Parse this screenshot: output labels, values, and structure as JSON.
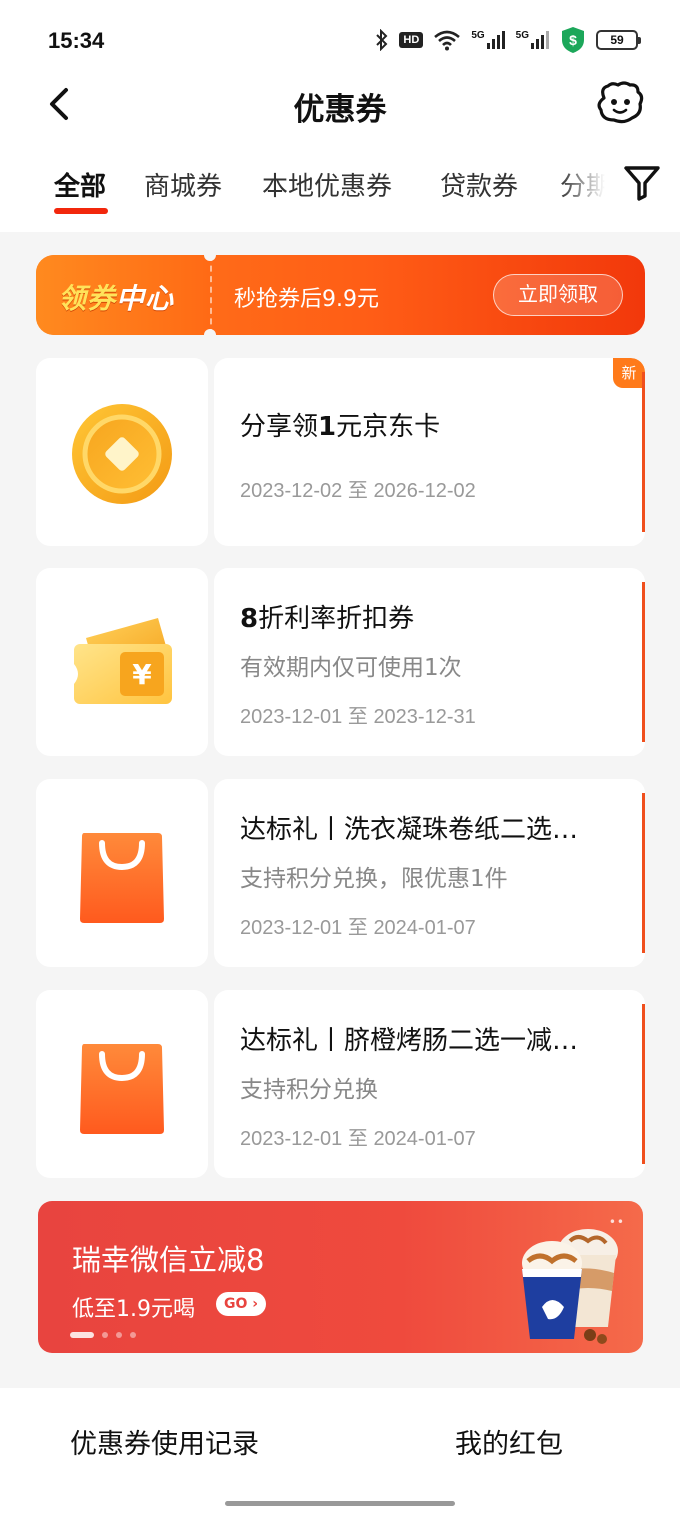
{
  "status_bar": {
    "time": "15:34",
    "hd_label": "HD",
    "network_1": "5G",
    "network_2": "5G",
    "battery": "59"
  },
  "header": {
    "title": "优惠券",
    "back_icon": "chevron-left-icon",
    "service_icon": "customer-service-icon"
  },
  "tabs": {
    "items": [
      "全部",
      "商城券",
      "本地优惠券",
      "贷款券",
      "分期"
    ],
    "active_index": 0,
    "filter_icon": "filter-icon"
  },
  "coupon_center": {
    "title_part1": "领券",
    "title_part2": "中心",
    "subtitle": "秒抢券后9.9元",
    "cta": "立即领取"
  },
  "coupons": [
    {
      "icon": "gold-coin-icon",
      "title_prefix": "分享领",
      "title_bold": "1",
      "title_suffix": "元京东卡",
      "description": "",
      "date_start": "2023-12-02",
      "date_sep": "至",
      "date_end": "2026-12-02",
      "badge": "新"
    },
    {
      "icon": "yuan-ticket-icon",
      "title_prefix": "",
      "title_bold": "8",
      "title_suffix": "折利率折扣券",
      "description": "有效期内仅可使用1次",
      "date_start": "2023-12-01",
      "date_sep": "至",
      "date_end": "2023-12-31"
    },
    {
      "icon": "shopping-bag-icon",
      "title_prefix": "达标礼丨洗衣凝珠卷纸二选…",
      "title_bold": "",
      "title_suffix": "",
      "description": "支持积分兑换，限优惠1件",
      "date_start": "2023-12-01",
      "date_sep": "至",
      "date_end": "2024-01-07"
    },
    {
      "icon": "shopping-bag-icon",
      "title_prefix": "达标礼丨脐橙烤肠二选一减…",
      "title_bold": "",
      "title_suffix": "",
      "description": "支持积分兑换",
      "date_start": "2023-12-01",
      "date_sep": "至",
      "date_end": "2024-01-07"
    }
  ],
  "promo": {
    "title": "瑞幸微信立减8",
    "subtitle": "低至1.9元喝",
    "go_label": "GO",
    "image": "coffee-cups-image"
  },
  "bottom": {
    "left_link": "优惠券使用记录",
    "right_link": "我的红包"
  },
  "colors": {
    "accent": "#f2270c",
    "banner_orange": "#ff6a15",
    "promo_red": "#e8443f"
  }
}
